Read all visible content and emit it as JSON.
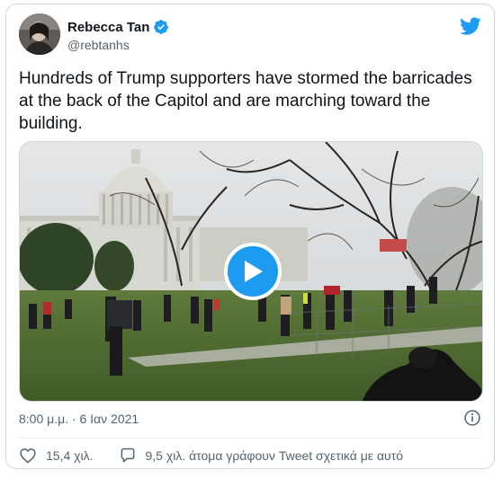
{
  "author": {
    "name": "Rebecca Tan",
    "handle": "@rebtanhs",
    "verified": true
  },
  "icons": {
    "verified": "verified-badge-icon",
    "platform": "twitter-bird-icon",
    "like": "heart-icon",
    "reply": "speech-bubble-icon",
    "info": "info-icon",
    "play": "play-icon"
  },
  "colors": {
    "accent": "#1d9bf0",
    "text": "#0f1419",
    "muted": "#536471"
  },
  "tweet": {
    "text": "Hundreds of Trump supporters have stormed the barricades at the back of the Capitol and are marching toward the building.",
    "timestamp": "8:00 μ.μ. · 6 Ιαν 2021"
  },
  "actions": {
    "likes": "15,4 χιλ.",
    "conversation": "9,5 χιλ. άτομα γράφουν Tweet σχετικά με αυτό"
  }
}
